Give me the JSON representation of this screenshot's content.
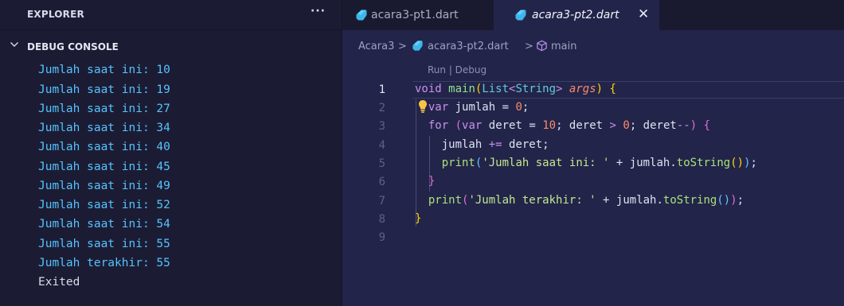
{
  "sidebar": {
    "explorer_title": "EXPLORER",
    "more_label": "···",
    "debug_console_title": "DEBUG CONSOLE",
    "console_lines": [
      "Jumlah saat ini: 10",
      "Jumlah saat ini: 19",
      "Jumlah saat ini: 27",
      "Jumlah saat ini: 34",
      "Jumlah saat ini: 40",
      "Jumlah saat ini: 45",
      "Jumlah saat ini: 49",
      "Jumlah saat ini: 52",
      "Jumlah saat ini: 54",
      "Jumlah saat ini: 55",
      "Jumlah terakhir: 55"
    ],
    "exited_text": "Exited"
  },
  "tabs": [
    {
      "label": "acara3-pt1.dart",
      "active": false,
      "icon": "dart-icon"
    },
    {
      "label": "acara3-pt2.dart",
      "active": true,
      "icon": "dart-icon",
      "close_label": "✕"
    }
  ],
  "breadcrumb": {
    "folder": "Acara3",
    "file": "acara3-pt2.dart",
    "symbol": "main",
    "separator": ">"
  },
  "editor": {
    "codelens": "Run | Debug",
    "line_numbers": [
      "1",
      "2",
      "3",
      "4",
      "5",
      "6",
      "7",
      "8",
      "9"
    ],
    "active_line": 1,
    "code": {
      "l1": {
        "void": "void",
        "main": "main",
        "open": "(",
        "list": "List",
        "lt": "<",
        "string": "String",
        "gt": ">",
        "args": "args",
        "close": ")",
        "brace": "{"
      },
      "l2": {
        "var": "var",
        "rest": "jumlah",
        "eq": " = ",
        "zero": "0",
        "semi": ";"
      },
      "l3": {
        "for": "for",
        "open": "(",
        "var": "var",
        "a": "deret",
        "eq": " = ",
        "ten": "10",
        "b": "; deret ",
        "gt": ">",
        "zero": "0",
        "c": "; deret",
        "dec": "--",
        "close": ")",
        "brace": "{"
      },
      "l4": {
        "text": "jumlah ",
        "op": "+=",
        "rest": " deret;"
      },
      "l5": {
        "print": "print",
        "open": "(",
        "str": "'Jumlah saat ini: '",
        "plus": " + ",
        "var": "jumlah.",
        "tostr": "toString",
        "parens": "()",
        "close": ")",
        "semi": ";"
      },
      "l6": {
        "brace": "}"
      },
      "l7": {
        "print": "print",
        "open": "(",
        "str": "'Jumlah terakhir: '",
        "plus": " + ",
        "var": "jumlah.",
        "tostr": "toString",
        "parens": "()",
        "close": ")",
        "semi": ";"
      },
      "l8": {
        "brace": "}"
      }
    }
  },
  "colors": {
    "console_text": "#57c2ff",
    "editor_bg": "#23244a",
    "sidebar_bg": "#1b1c33",
    "dart_icon": "#3fb6e8"
  }
}
